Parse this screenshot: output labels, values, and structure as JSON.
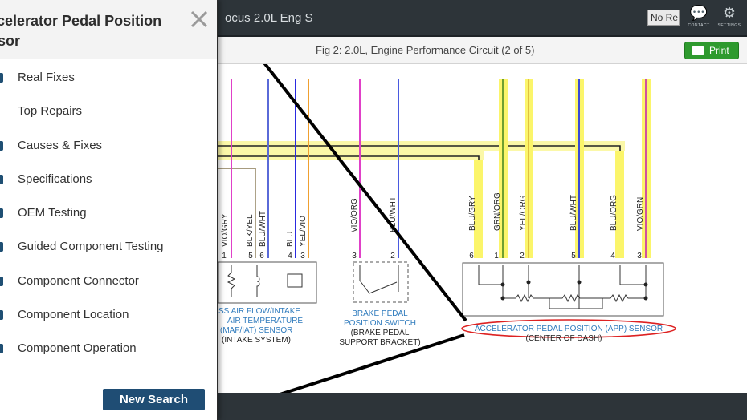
{
  "app": {
    "vehicle_title": "ocus 2.0L Eng S",
    "no_re_button": "No Re",
    "contact_label": "CONTACT",
    "settings_label": "SETTINGS"
  },
  "figure": {
    "title": "Fig 2: 2.0L, Engine Performance Circuit (2 of 5)",
    "print_label": "Print"
  },
  "panel": {
    "title": "ccelerator Pedal Position nsor",
    "items": [
      {
        "label": "Real Fixes"
      },
      {
        "label": "Top Repairs"
      },
      {
        "label": "Causes & Fixes"
      },
      {
        "label": "Specifications"
      },
      {
        "label": "OEM Testing"
      },
      {
        "label": "Guided Component Testing"
      },
      {
        "label": "Component Connector"
      },
      {
        "label": "Component Location"
      },
      {
        "label": "Component Operation"
      }
    ],
    "new_search_label": "New Search"
  },
  "diagram": {
    "maf_wires": [
      {
        "color": "VIO/GRY",
        "pin": "1"
      },
      {
        "color": "BLK/YEL",
        "pin": "5"
      },
      {
        "color": "BLU/WHT",
        "pin": "6"
      },
      {
        "color": "BLU",
        "pin": "4"
      },
      {
        "color": "YEL/VIO",
        "pin": "3"
      }
    ],
    "maf_label": [
      "SS AIR FLOW/INTAKE",
      "AIR TEMPERATURE",
      "(MAF/IAT) SENSOR"
    ],
    "maf_sublabel": "(INTAKE SYSTEM)",
    "bpp_wires": [
      {
        "color": "VIO/ORG",
        "pin": "3"
      },
      {
        "color": "BLU/WHT",
        "pin": "2"
      }
    ],
    "bpp_label": [
      "BRAKE PEDAL",
      "POSITION SWITCH"
    ],
    "bpp_sublabel": [
      "(BRAKE PEDAL",
      "SUPPORT BRACKET)"
    ],
    "app_wires": [
      {
        "color": "BLU/GRY",
        "pin": "6"
      },
      {
        "color": "GRN/ORG",
        "pin": "1"
      },
      {
        "color": "YEL/ORG",
        "pin": "2"
      },
      {
        "color": "BLU/WHT",
        "pin": "5"
      },
      {
        "color": "BLU/ORG",
        "pin": "4"
      },
      {
        "color": "VIO/GRN",
        "pin": "3"
      }
    ],
    "app_label": "ACCELERATOR PEDAL POSITION (APP) SENSOR",
    "app_sublabel": "(CENTER OF DASH)"
  }
}
